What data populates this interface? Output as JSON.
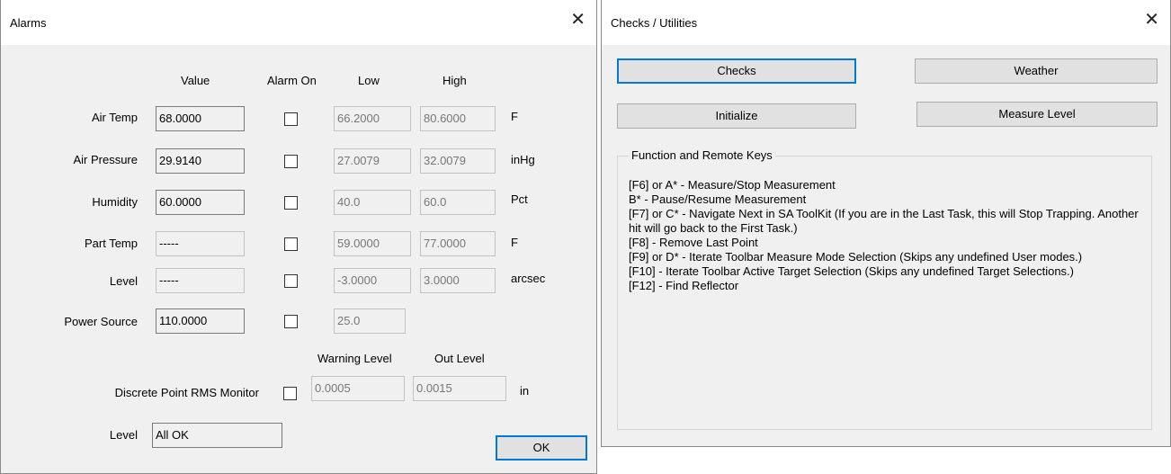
{
  "alarms": {
    "title": "Alarms",
    "close": "✕",
    "headers": {
      "value": "Value",
      "alarm_on": "Alarm On",
      "low": "Low",
      "high": "High"
    },
    "rows": [
      {
        "label": "Air Temp",
        "value": "68.0000",
        "checked": false,
        "low": "66.2000",
        "high": "80.6000",
        "unit": "F"
      },
      {
        "label": "Air Pressure",
        "value": "29.9140",
        "checked": false,
        "low": "27.0079",
        "high": "32.0079",
        "unit": "inHg"
      },
      {
        "label": "Humidity",
        "value": "60.0000",
        "checked": false,
        "low": "40.0",
        "high": "60.0",
        "unit": "Pct"
      },
      {
        "label": "Part Temp",
        "value": "-----",
        "checked": false,
        "low": "59.0000",
        "high": "77.0000",
        "unit": "F"
      },
      {
        "label": "Level",
        "value": "-----",
        "checked": false,
        "low": "-3.0000",
        "high": "3.0000",
        "unit": "arcsec"
      },
      {
        "label": "Power Source",
        "value": "110.0000",
        "checked": false,
        "low": "25.0"
      }
    ],
    "rms": {
      "warning_header": "Warning Level",
      "out_header": "Out Level",
      "label": "Discrete Point RMS Monitor",
      "checked": false,
      "warning": "0.0005",
      "out": "0.0015",
      "unit": "in"
    },
    "level_status": {
      "label": "Level",
      "value": "All OK"
    },
    "ok_button": "OK"
  },
  "checks": {
    "title": "Checks / Utilities",
    "close": "✕",
    "buttons": {
      "checks": "Checks",
      "weather": "Weather",
      "initialize": "Initialize",
      "measure_level": "Measure Level"
    },
    "group_label": "Function and Remote Keys",
    "keys": [
      "[F6] or A* - Measure/Stop Measurement",
      "B* - Pause/Resume Measurement",
      "[F7] or C* - Navigate Next in SA ToolKit (If you are in the Last Task, this will Stop Trapping.  Another hit will go back to the First Task.)",
      "[F8] - Remove Last Point",
      "[F9] or D* - Iterate Toolbar Measure Mode Selection (Skips any undefined User modes.)",
      "[F10] - Iterate Toolbar Active Target Selection (Skips any undefined Target Selections.)",
      "[F12] - Find Reflector"
    ]
  }
}
